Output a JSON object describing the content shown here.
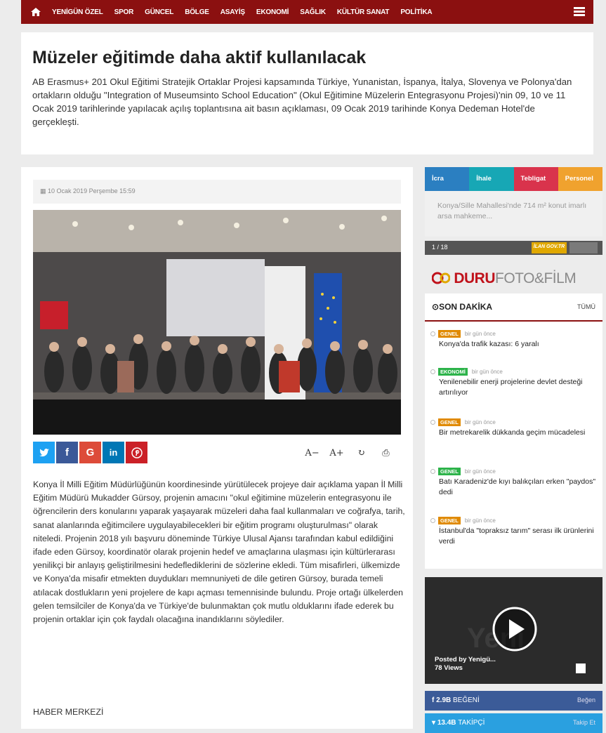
{
  "nav": {
    "items": [
      "YENİGÜN ÖZEL",
      "SPOR",
      "GÜNCEL",
      "BÖLGE",
      "ASAYİŞ",
      "EKONOMİ",
      "SAĞLIK",
      "KÜLTÜR SANAT",
      "POLİTİKA"
    ]
  },
  "hero": {
    "title": "Müzeler eğitimde daha aktif kullanılacak",
    "summary": "AB Erasmus+ 201 Okul Eğitimi Stratejik Ortaklar Projesi kapsamında Türkiye, Yunanistan, İspanya, İtalya, Slovenya ve Polonya'dan ortakların olduğu \"Integration of Museumsinto School Education\" (Okul Eğitimine Müzelerin Entegrasyonu Projesi)'nin 09, 10 ve 11 Ocak 2019 tarihlerinde yapılacak açılış toplantısına ait basın açıklaması, 09 Ocak 2019 tarihinde Konya Dedeman Hotel'de gerçekleşti."
  },
  "article": {
    "date": "10 Ocak 2019 Perşembe 15:59",
    "share": [
      "t",
      "f",
      "G",
      "in",
      "p"
    ],
    "tools": [
      "A−",
      "A+",
      "↻",
      "⎙"
    ],
    "body": "Konya İl Milli Eğitim Müdürlüğünün koordinesinde yürütülecek projeye dair açıklama yapan İl Milli Eğitim Müdürü Mukadder Gürsoy, projenin amacını \"okul eğitimine müzelerin entegrasyonu ile öğrencilerin ders konularını yaparak yaşayarak müzeleri daha faal kullanmaları ve coğrafya, tarih, sanat alanlarında eğitimcilere uygulayabilecekleri bir eğitim programı oluşturulması\" olarak niteledi. Projenin 2018 yılı başvuru döneminde Türkiye Ulusal Ajansı tarafından kabul edildiğini ifade eden Gürsoy, koordinatör olarak projenin hedef ve amaçlarına ulaşması için kültürlerarası yenilikçi bir anlayış geliştirilmesini hedeflediklerini de sözlerine ekledi. Tüm misafirleri, ülkemizde ve Konya'da misafir etmekten duydukları memnuniyeti de dile getiren Gürsoy, burada temeli atılacak dostlukların yeni projelere de kapı açması temennisinde bulundu. Proje ortağı ülkelerden gelen temsilciler de Konya'da ve Türkiye'de bulunmaktan çok mutlu olduklarını ifade ederek bu projenin ortaklar için çok faydalı olacağına inandıklarını söylediler.",
    "signature": "HABER MERKEZİ"
  },
  "sidebar": {
    "tabs": [
      {
        "label": "İcra",
        "color": "#2b7fc1"
      },
      {
        "label": "İhale",
        "color": "#17a7b5"
      },
      {
        "label": "Tebligat",
        "color": "#d9334c"
      },
      {
        "label": "Personel",
        "color": "#f0a22e"
      }
    ],
    "ilan_text": "Konya/Sille Mahallesi'nde 714 m² konut imarlı arsa mahkeme...",
    "pager": "1 / 18",
    "ilan_logo": "İLAN GOV.TR",
    "sponsor_bold": "DURU",
    "sponsor_light": "FOTO&FİLM",
    "son_dakika": {
      "title": "SON DAKİKA",
      "all_label": "TÜMÜ",
      "items": [
        {
          "category": "GENEL",
          "cat_color": "#e08a00",
          "time": "bir gün önce",
          "title": "Konya'da trafik kazası: 6 yaralı"
        },
        {
          "category": "EKONOMİ",
          "cat_color": "#2db34a",
          "time": "bir gün önce",
          "title": "Yenilenebilir enerji projelerine devlet desteği artırılıyor"
        },
        {
          "category": "GENEL",
          "cat_color": "#e08a00",
          "time": "bir gün önce",
          "title": "Bir metrekarelik dükkanda geçim mücadelesi"
        },
        {
          "category": "GENEL",
          "cat_color": "#2db34a",
          "time": "bir gün önce",
          "title": "Batı Karadeniz'de kıyı balıkçıları erken \"paydos\" dedi"
        },
        {
          "category": "GENEL",
          "cat_color": "#e08a00",
          "time": "bir gün önce",
          "title": "İstanbul'da \"topraksız tarım\" serası ilk ürünlerini verdi"
        }
      ]
    },
    "video": {
      "posted_by": "Posted by Yenigü...",
      "views": "78 Views"
    },
    "facebook": {
      "count": "2.9B",
      "label": "BEĞENİ",
      "action": "Beğen",
      "color": "#3b5b98"
    },
    "twitter": {
      "count": "13.4B",
      "label": "TAKİPÇİ",
      "action": "Takip Et",
      "color": "#2aa0e0"
    }
  }
}
